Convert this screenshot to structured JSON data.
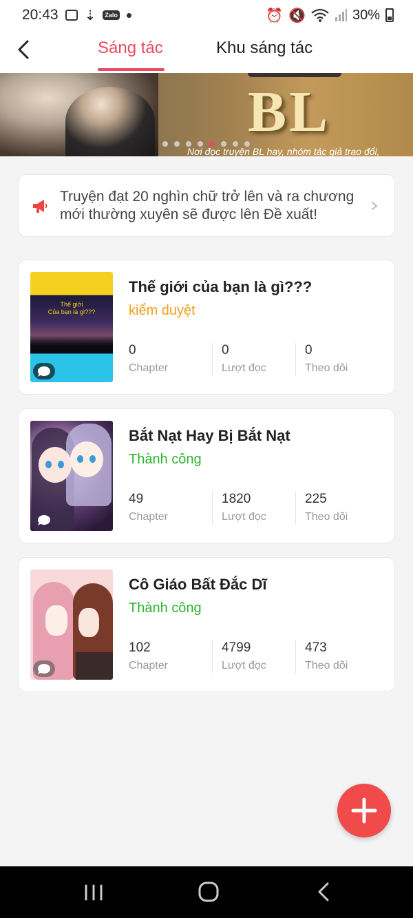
{
  "status_bar": {
    "time": "20:43",
    "zalo_label": "Zalo",
    "battery": "30%"
  },
  "header": {
    "tabs": [
      {
        "label": "Sáng tác",
        "active": true
      },
      {
        "label": "Khu sáng tác",
        "active": false
      }
    ]
  },
  "banner": {
    "title": "BL",
    "caption": "Nơi đọc truyện BL hay, nhóm tác giả trao đổi,",
    "slide_count": 8,
    "active_slide": 4
  },
  "notice": {
    "text": "Truyện đạt 20 nghìn chữ trở lên và ra chương mới thường xuyên sẽ được lên Đề xuất!"
  },
  "stories": [
    {
      "title": "Thế giới của bạn là gì???",
      "status": "kiểm duyệt",
      "status_color": "#f0a020",
      "cover_text": "Thế giới\nCủa bạn là gì???",
      "stats": [
        {
          "value": "0",
          "label": "Chapter"
        },
        {
          "value": "0",
          "label": "Lượt đọc"
        },
        {
          "value": "0",
          "label": "Theo dõi"
        }
      ]
    },
    {
      "title": "Bắt Nạt Hay Bị Bắt Nạt",
      "status": "Thành công",
      "status_color": "#2bb52b",
      "stats": [
        {
          "value": "49",
          "label": "Chapter"
        },
        {
          "value": "1820",
          "label": "Lượt đọc"
        },
        {
          "value": "225",
          "label": "Theo dõi"
        }
      ]
    },
    {
      "title": "Cô Giáo Bất Đắc Dĩ",
      "status": "Thành công",
      "status_color": "#2bb52b",
      "stats": [
        {
          "value": "102",
          "label": "Chapter"
        },
        {
          "value": "4799",
          "label": "Lượt đọc"
        },
        {
          "value": "473",
          "label": "Theo dõi"
        }
      ]
    }
  ],
  "colors": {
    "accent": "#e84a5f",
    "fab": "#f04a4a"
  },
  "icons": {
    "back": "chevron-left-icon",
    "notice": "megaphone-icon",
    "chevron": "chevron-right-icon",
    "fab": "plus-icon",
    "comment": "comment-bubble-icon"
  }
}
